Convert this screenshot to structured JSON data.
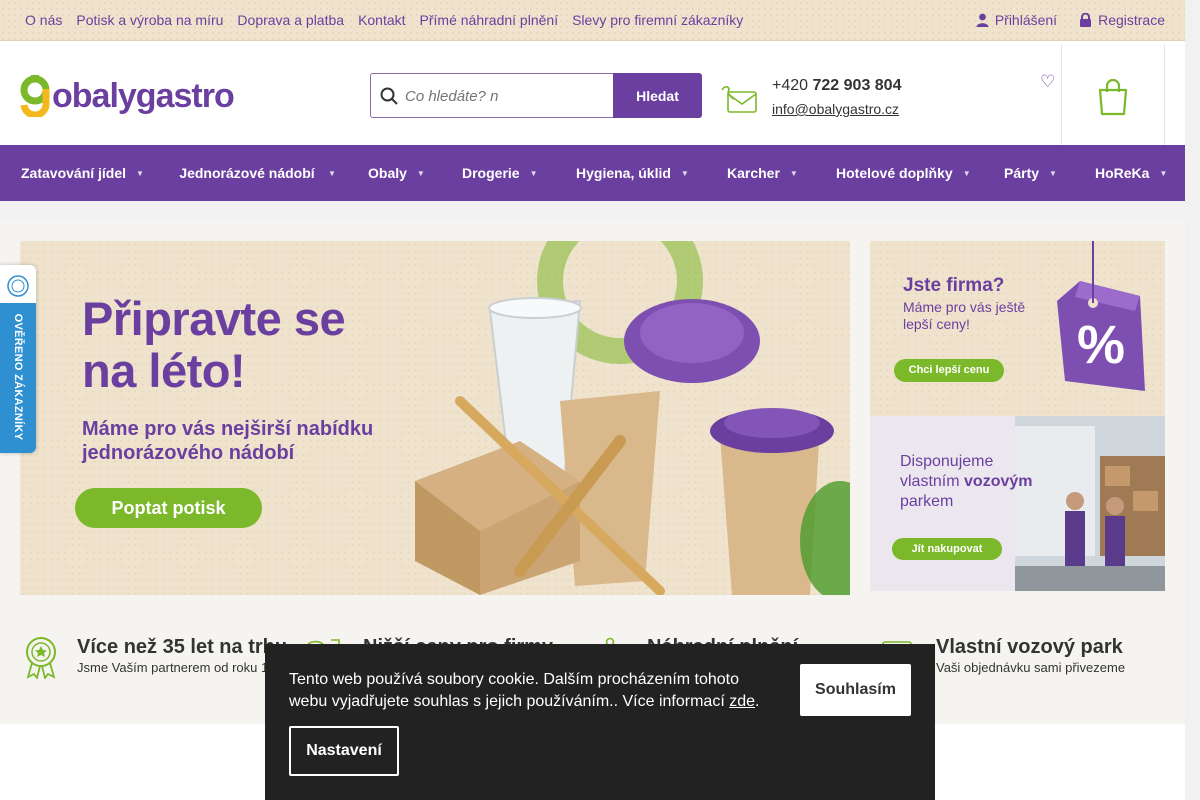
{
  "topbar": {
    "links": [
      "O nás",
      "Potisk a výroba na míru",
      "Doprava a platba",
      "Kontakt",
      "Přímé náhradní plnění",
      "Slevy pro firemní zákazníky"
    ],
    "login": "Přihlášení",
    "register": "Registrace"
  },
  "header": {
    "logo_text": "obalygastro",
    "search_placeholder": "Co hledáte? n",
    "search_button": "Hledat",
    "phone_prefix": "+420",
    "phone_number": "722 903 804",
    "email": "info@obalygastro.cz"
  },
  "nav": {
    "items": [
      "Zatavování jídel",
      "Jednorázové nádobí",
      "Obaly",
      "Drogerie",
      "Hygiena, úklid",
      "Karcher",
      "Hotelové doplňky",
      "Párty",
      "HoReKa"
    ]
  },
  "hero": {
    "title_line1": "Připravte se",
    "title_line2": "na léto!",
    "subtitle_line1": "Máme pro vás nejširší nabídku",
    "subtitle_line2": "jednorázového nádobí",
    "cta": "Poptat potisk"
  },
  "side_banner_1": {
    "title": "Jste firma?",
    "text": "Máme pro vás ještě lepší ceny!",
    "cta": "Chci lepší cenu"
  },
  "side_banner_2": {
    "text_part1": "Disponujeme vlastním ",
    "text_strong": "vozovým",
    "text_part2": " parkem",
    "cta": "Jít nakupovat"
  },
  "badge": {
    "text": "OVĚŘENO ZÁKAZNÍKY"
  },
  "features": [
    {
      "title": "Více než 35 let na trhu",
      "desc": "Jsme Vaším partnerem od roku 1"
    },
    {
      "title": "Nižší ceny pro firmy",
      "desc": ""
    },
    {
      "title": "Náhradní plnění",
      "desc": ""
    },
    {
      "title": "Vlastní vozový park",
      "desc": "Vaši objednávku sami přivezeme"
    }
  ],
  "cookie": {
    "message": "Tento web používá soubory cookie. Dalším procházením tohoto webu vyjadřujete souhlas s jejich používáním.. Více informací ",
    "link": "zde",
    "after_link": ".",
    "accept": "Souhlasím",
    "settings": "Nastavení"
  },
  "colors": {
    "brand_purple": "#6b3fa0",
    "brand_green": "#7bb82a",
    "sand": "#efe3cd"
  }
}
